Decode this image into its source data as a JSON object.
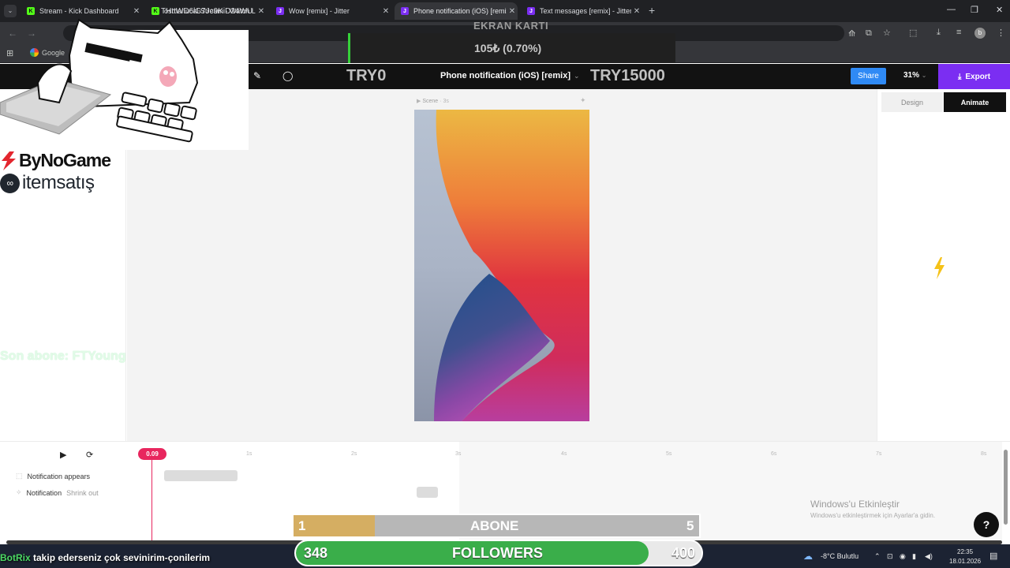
{
  "browser": {
    "tabs": [
      {
        "title": "Stream - Kick Dashboard",
        "favicon": "kick-icon",
        "color": "#53fc18",
        "active": false
      },
      {
        "title": "osmanucal Stream - Watch Live",
        "favicon": "kick-icon",
        "color": "#53fc18",
        "active": false
      },
      {
        "title": "Wow [remix] - Jitter",
        "favicon": "jitter-icon",
        "color": "#7b2ef2",
        "active": false
      },
      {
        "title": "Phone notification (iOS) [remix]",
        "favicon": "jitter-icon",
        "color": "#7b2ef2",
        "active": true
      },
      {
        "title": "Text messages [remix] - Jitter",
        "favicon": "jitter-icon",
        "color": "#7b2ef2",
        "active": false
      }
    ],
    "url_fragment": "THttWD6lG7Jc9KiD24WU",
    "bookmark": "Google",
    "profile_initial": "b"
  },
  "jitter": {
    "doc_title": "Phone notification (iOS) [remix]",
    "share_label": "Share",
    "zoom": "31%",
    "export_label": "Export",
    "scene_label": "Scene",
    "scene_duration": "3s",
    "panel_tabs": {
      "design": "Design",
      "animate": "Animate"
    },
    "accent": "#7b2ef2"
  },
  "timeline": {
    "playhead": "0.09",
    "ticks": [
      "1s",
      "2s",
      "3s",
      "4s",
      "5s",
      "6s",
      "7s",
      "8s"
    ],
    "rows": [
      {
        "label": "Notification appears",
        "sub": ""
      },
      {
        "label": "Notification",
        "sub": "Shrink out"
      }
    ]
  },
  "windows": {
    "activate_title": "Windows'u Etkinleştir",
    "activate_sub": "Windows'u etkinleştirmek için Ayarlar'a gidin.",
    "weather": "-8°C  Bulutlu",
    "time": "22:35",
    "date": "18.01.2026"
  },
  "overlay": {
    "gpu_heading": "EKRAN KARTI",
    "gpu_price": "105₺ (0.70%)",
    "goal_start": "TRY0",
    "goal_end": "TRY15000",
    "sponsor1": "ByNoGame",
    "sponsor2": "itemsatış",
    "last_sub": "Son abone: FTYoung",
    "sub_goal": {
      "label": "ABONE",
      "current": "1",
      "target": "5",
      "progress": 0.2
    },
    "follower_goal": {
      "label": "FOLLOWERS",
      "current": "348",
      "target": "400",
      "progress": 0.87
    },
    "chat_user": "BotRix",
    "chat_message": "takip ederseniz çok sevinirim-çonilerim"
  }
}
